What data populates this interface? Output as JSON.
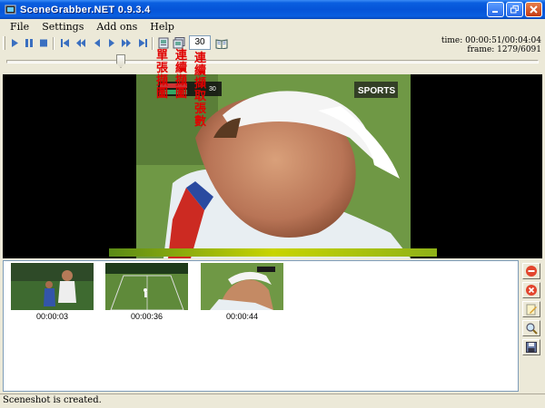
{
  "window": {
    "title": "SceneGrabber.NET 0.9.3.4"
  },
  "menu": [
    "File",
    "Settings",
    "Add ons",
    "Help"
  ],
  "toolbar": {
    "capture_count": "30",
    "time_label": "time: 00:00:51/00:04:04",
    "frame_label": "frame: 1279/6091"
  },
  "slider": {
    "position_fraction": 0.2
  },
  "annotations": {
    "single": "單張擷圖",
    "continuous": "連續擷圖",
    "count": "連續擷取張數"
  },
  "video": {
    "channel_logo": "SPORTS",
    "score_value": "30"
  },
  "thumbnails": [
    {
      "time": "00:00:03"
    },
    {
      "time": "00:00:36"
    },
    {
      "time": "00:00:44"
    }
  ],
  "side_buttons": [
    "remove-all",
    "remove",
    "edit",
    "search",
    "save"
  ],
  "status": {
    "text": "Sceneshot is created."
  },
  "colors": {
    "annotation": "#e00000",
    "titlebar": "#0554d8"
  }
}
